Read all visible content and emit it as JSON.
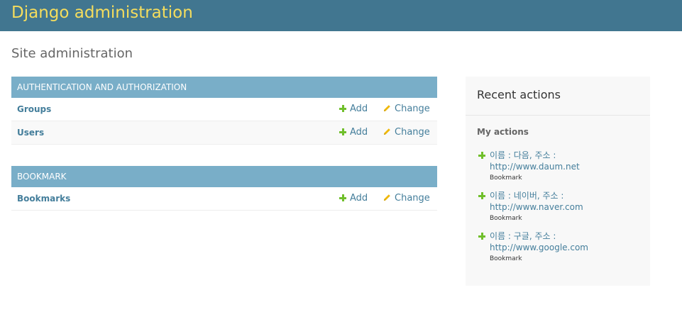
{
  "header": {
    "branding": "Django administration"
  },
  "page": {
    "title": "Site administration"
  },
  "modules": [
    {
      "caption": "AUTHENTICATION AND AUTHORIZATION",
      "models": [
        {
          "name": "Groups",
          "add_label": "Add",
          "change_label": "Change"
        },
        {
          "name": "Users",
          "add_label": "Add",
          "change_label": "Change"
        }
      ]
    },
    {
      "caption": "BOOKMARK",
      "models": [
        {
          "name": "Bookmarks",
          "add_label": "Add",
          "change_label": "Change"
        }
      ]
    }
  ],
  "recent_actions": {
    "title": "Recent actions",
    "subtitle": "My actions",
    "items": [
      {
        "text": "이름 : 다음, 주소 : http://www.daum.net",
        "type": "Bookmark"
      },
      {
        "text": "이름 : 네이버, 주소 : http://www.naver.com",
        "type": "Bookmark"
      },
      {
        "text": "이름 : 구글, 주소 : http://www.google.com",
        "type": "Bookmark"
      }
    ]
  },
  "colors": {
    "header_bg": "#417690",
    "branding": "#f5dd5d",
    "caption_bg": "#79aec8",
    "link": "#447e9b",
    "add_icon": "#70bf2b",
    "change_icon": "#efb80b"
  }
}
